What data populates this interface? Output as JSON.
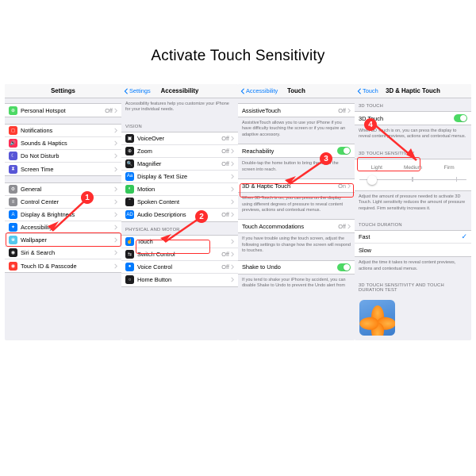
{
  "title": "Activate Touch Sensitivity",
  "panel1": {
    "nav": "Settings",
    "rows1": [
      {
        "icon": "hotspot",
        "bg": "#4cd964",
        "label": "Personal Hotspot",
        "val": "Off"
      }
    ],
    "rows2": [
      {
        "icon": "bell",
        "bg": "#ff3b30",
        "label": "Notifications"
      },
      {
        "icon": "speaker",
        "bg": "#ff2d55",
        "label": "Sounds & Haptics"
      },
      {
        "icon": "moon",
        "bg": "#5856d6",
        "label": "Do Not Disturb"
      },
      {
        "icon": "hourglass",
        "bg": "#5856d6",
        "label": "Screen Time"
      }
    ],
    "rows3": [
      {
        "icon": "gear",
        "bg": "#8e8e93",
        "label": "General"
      },
      {
        "icon": "sliders",
        "bg": "#8e8e93",
        "label": "Control Center"
      },
      {
        "icon": "display",
        "bg": "#007aff",
        "label": "Display & Brightness"
      },
      {
        "icon": "acc",
        "bg": "#007aff",
        "label": "Accessibility"
      },
      {
        "icon": "wall",
        "bg": "#54c7ec",
        "label": "Wallpaper"
      },
      {
        "icon": "siri",
        "bg": "#1c1c1e",
        "label": "Siri & Search"
      },
      {
        "icon": "touchid",
        "bg": "#ff3b30",
        "label": "Touch ID & Passcode"
      }
    ]
  },
  "panel2": {
    "back": "Settings",
    "nav": "Accessibility",
    "intro": "Accessibility features help you customize your iPhone for your individual needs.",
    "hdr_vision": "VISION",
    "vision": [
      {
        "icon": "voice",
        "bg": "#1c1c1e",
        "label": "VoiceOver",
        "val": "Off"
      },
      {
        "icon": "zoom",
        "bg": "#1c1c1e",
        "label": "Zoom",
        "val": "Off"
      },
      {
        "icon": "mag",
        "bg": "#1c1c1e",
        "label": "Magnifier",
        "val": "Off"
      },
      {
        "icon": "text",
        "bg": "#007aff",
        "label": "Display & Text Size"
      },
      {
        "icon": "motion",
        "bg": "#34c759",
        "label": "Motion"
      },
      {
        "icon": "spoken",
        "bg": "#1c1c1e",
        "label": "Spoken Content"
      },
      {
        "icon": "audio",
        "bg": "#007aff",
        "label": "Audio Descriptions",
        "val": "Off"
      }
    ],
    "hdr_motor": "PHYSICAL AND MOTOR",
    "motor": [
      {
        "icon": "touch",
        "bg": "#007aff",
        "label": "Touch"
      },
      {
        "icon": "switch",
        "bg": "#1c1c1e",
        "label": "Switch Control",
        "val": "Off"
      },
      {
        "icon": "voicectl",
        "bg": "#007aff",
        "label": "Voice Control",
        "val": "Off"
      },
      {
        "icon": "home",
        "bg": "#1c1c1e",
        "label": "Home Button"
      }
    ]
  },
  "panel3": {
    "back": "Accessibility",
    "nav": "Touch",
    "g1_label": "AssistiveTouch",
    "g1_val": "Off",
    "g1_ftr": "AssistiveTouch allows you to use your iPhone if you have difficulty touching the screen or if you require an adaptive accessory.",
    "g2_label": "Reachability",
    "g2_ftr": "Double-tap the home button to bring the top of the screen into reach.",
    "g3_label": "3D & Haptic Touch",
    "g3_val": "On",
    "g3_ftr": "When 3D Touch is on, you can press on the display using different degrees of pressure to reveal content previews, actions and contextual menus.",
    "g4_label": "Touch Accommodations",
    "g4_val": "Off",
    "g4_ftr": "If you have trouble using the touch screen, adjust the following settings to change how the screen will respond to touches.",
    "g5_label": "Shake to Undo",
    "g5_ftr": "If you tend to shake your iPhone by accident, you can disable Shake to Undo to prevent the Undo alert from"
  },
  "panel4": {
    "back": "Touch",
    "nav": "3D & Haptic Touch",
    "hdr1": "3D TOUCH",
    "row1": "3D Touch",
    "ftr1": "When 3D Touch is on, you can press the display to reveal content previews, actions and contextual menus.",
    "hdr2": "3D TOUCH SENSITIVITY",
    "seg": [
      "Light",
      "Medium",
      "Firm"
    ],
    "ftr2": "Adjust the amount of pressure needed to activate 3D Touch. Light sensitivity reduces the amount of pressure required. Firm sensitivity increases it.",
    "hdr3": "TOUCH DURATION",
    "dur": [
      {
        "label": "Fast",
        "sel": true
      },
      {
        "label": "Slow",
        "sel": false
      }
    ],
    "ftr3": "Adjust the time it takes to reveal content previews, actions and contextual menus.",
    "hdr4": "3D TOUCH SENSITIVITY AND TOUCH DURATION TEST"
  }
}
